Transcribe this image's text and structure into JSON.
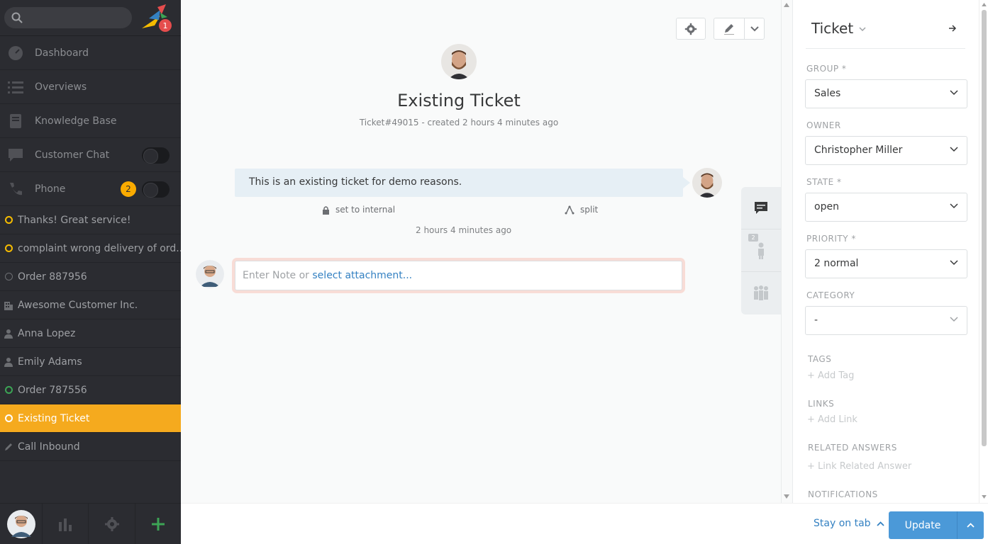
{
  "sidebar": {
    "search_placeholder": "",
    "logo_badge": "1",
    "nav": [
      {
        "label": "Dashboard",
        "icon": "dashboard-icon"
      },
      {
        "label": "Overviews",
        "icon": "list-icon"
      },
      {
        "label": "Knowledge Base",
        "icon": "book-icon"
      },
      {
        "label": "Customer Chat",
        "icon": "chat-icon"
      },
      {
        "label": "Phone",
        "icon": "phone-icon",
        "count": "2"
      }
    ],
    "tasks": [
      {
        "label": "Thanks! Great service!"
      },
      {
        "label": "complaint wrong delivery of ord..."
      },
      {
        "label": "Order 887956"
      },
      {
        "label": "Awesome Customer Inc."
      },
      {
        "label": "Anna Lopez"
      },
      {
        "label": "Emily Adams"
      },
      {
        "label": "Order 787556"
      },
      {
        "label": "Existing Ticket"
      },
      {
        "label": "Call Inbound"
      }
    ]
  },
  "ticket": {
    "title": "Existing Ticket",
    "meta": "Ticket#49015 - created 2 hours 4 minutes ago",
    "article_body": "This is an existing ticket for demo reasons.",
    "action_internal": "set to internal",
    "action_split": "split",
    "article_time": "2 hours 4 minutes ago",
    "reply_placeholder": "Enter Note or ",
    "reply_attachment_link": "select attachment...",
    "sidetab_badge": "2"
  },
  "panel": {
    "title": "Ticket",
    "group_label": "GROUP *",
    "group_value": "Sales",
    "owner_label": "OWNER",
    "owner_value": "Christopher Miller",
    "state_label": "STATE *",
    "state_value": "open",
    "priority_label": "PRIORITY *",
    "priority_value": "2 normal",
    "category_label": "CATEGORY",
    "category_value": "-",
    "tags_label": "TAGS",
    "tags_add": "+ Add Tag",
    "links_label": "LINKS",
    "links_add": "+ Add Link",
    "related_label": "RELATED ANSWERS",
    "related_add": "+ Link Related Answer",
    "notifications_label": "NOTIFICATIONS"
  },
  "footer": {
    "stay_on_tab": "Stay on tab",
    "update": "Update"
  },
  "colors": {
    "sidebar_bg": "#2b2c31",
    "active_task": "#f5aa1e",
    "accent_blue": "#4b99d8",
    "link_blue": "#3481c2"
  }
}
